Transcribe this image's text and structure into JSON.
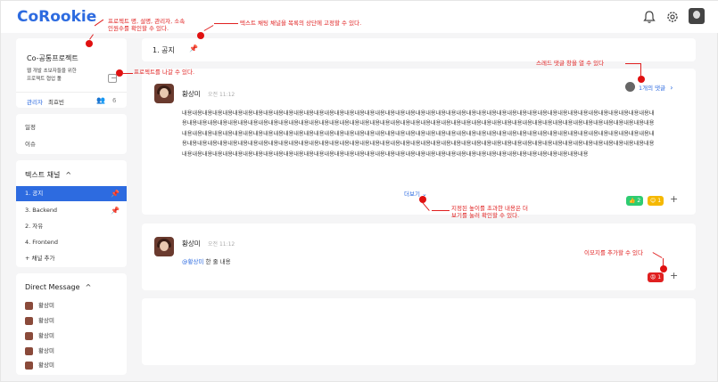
{
  "app": {
    "logo": "CoRookie"
  },
  "header_icons": [
    "bell-icon",
    "gear-icon",
    "user-avatar"
  ],
  "project": {
    "name": "Co-공통프로젝트",
    "description_line1": "웹 개발 초보자들을 위한",
    "description_line2": "프로젝트 협업 툴",
    "admin_label": "관리자",
    "admin_name": "최효빈",
    "member_count": "6"
  },
  "menu": {
    "schedule": "일정",
    "issue": "이슈"
  },
  "text_channels": {
    "title": "텍스트 채널",
    "items": [
      {
        "label": "1. 공지",
        "pinned": true,
        "active": true
      },
      {
        "label": "3. Backend",
        "pinned": true,
        "active": false
      },
      {
        "label": "2. 자유",
        "pinned": false,
        "active": false
      },
      {
        "label": "4. Frontend",
        "pinned": false,
        "active": false
      }
    ],
    "add_label": "+ 채널 추가"
  },
  "direct_messages": {
    "title": "Direct Message",
    "items": [
      "황상미",
      "황상미",
      "황상미",
      "황상미",
      "황상미"
    ]
  },
  "channel_header": {
    "title": "1. 공지"
  },
  "message1": {
    "author": "황상미",
    "time": "오전 11:12",
    "thread_label": "1개의 댓글",
    "content": "내용내용내용내용내용내용내용내용내용내용내용내용내용내용내용내용내용내용내용내용내용내용내용내용내용내용내용내용내용내용내용내용내용내용내용내용내용내용내용내용내용내용내용내용내용내용내용내용내용내용내용내용내용내용내용내용내용내용내용내용내용내용내용내용내용내용내용내용내용내용내용내용내용내용내용내용내용내용내용내용내용내용내용내용내용내용내용내용내용내용내용내용내용내용내용내용내용내용내용내용내용내용내용내용내용내용내용내용내용내용내용내용내용내용내용내용내용내용내용내용내용내용내용내용내용내용내용내용내용내용내용내용내용내용내용내용내용내용내용내용내용내용내용내용내용내용내용내용내용내용내용내용내용내용내용내용내용내용내용내용내용내용내용내용내용내용내용내용내용내용내용내용내용내용내용내용내용내용내용내용내용내용내용내용내용내용내용내용내용내용내용내용내용내용내용내용내용내용내용내용내용내용내용내용내용내용내용내용내용내용내용내용내용내용내용내용내용내용내용내용내용내용내용내용내용내용",
    "more_label": "더보기",
    "reactions": [
      {
        "emoji": "👍",
        "count": "2",
        "color": "#2ecc71"
      },
      {
        "emoji": "😊",
        "count": "1",
        "color": "#f5b800"
      }
    ]
  },
  "message2": {
    "author": "황상미",
    "time": "오전 11:12",
    "mention": "@황상미",
    "text": " 한 줄 내용",
    "reactions": [
      {
        "emoji": "😡",
        "count": "1",
        "color": "#e02020"
      }
    ]
  },
  "annotations": {
    "a1_line1": "프로젝트 명, 설명, 관리자, 소속",
    "a1_line2": "인원수를 확인할 수 있다.",
    "a2": "텍스트 채팅 채널을 목록의 상단에 고정할 수 있다.",
    "a3": "프로젝트를 나갈 수 있다.",
    "a4": "스레드 댓글 창을 열 수 있다",
    "a5_line1": "지정된 높이를 초과한 내용은 더",
    "a5_line2": "보기를 눌러 확인할 수 있다.",
    "a6": "이모지를 추가할 수 있다"
  },
  "colors": {
    "accent": "#2d6be0",
    "annotation": "#e02020"
  }
}
